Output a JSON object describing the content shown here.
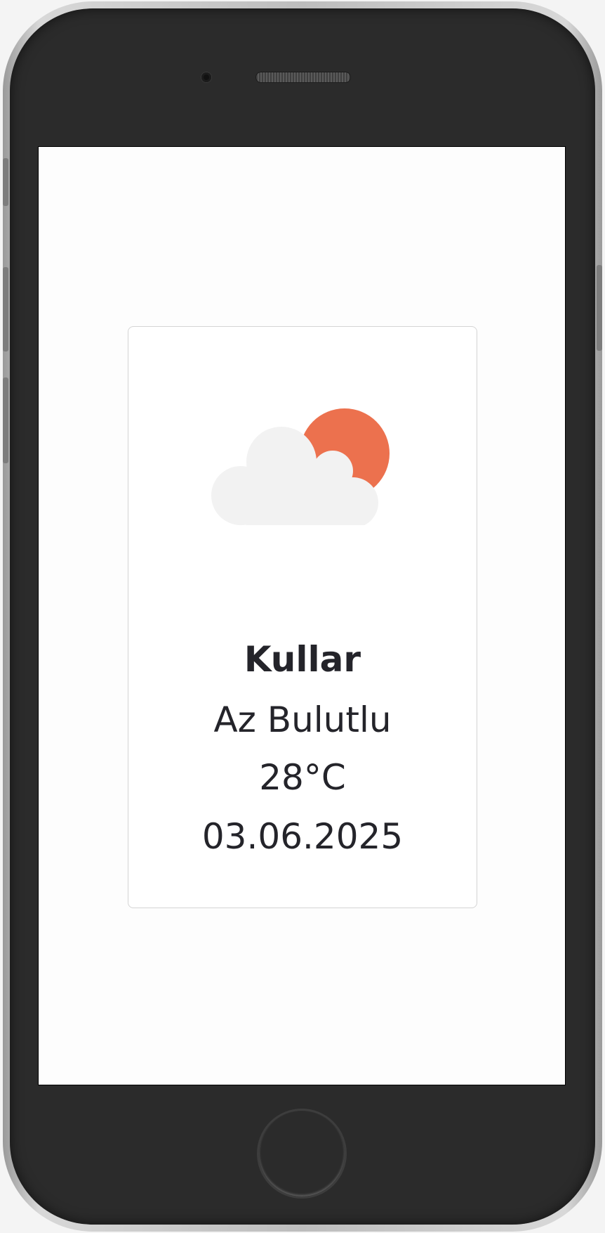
{
  "weather": {
    "city": "Kullar",
    "condition": "Az Bulutlu",
    "temperature": "28°C",
    "date": "03.06.2025",
    "icon": "partly-cloudy-icon"
  },
  "colors": {
    "sun": "#ec714e",
    "cloud": "#f2f2f2",
    "text": "#24242a",
    "card_border": "#d4d4d4",
    "phone_body": "#2b2b2b"
  }
}
